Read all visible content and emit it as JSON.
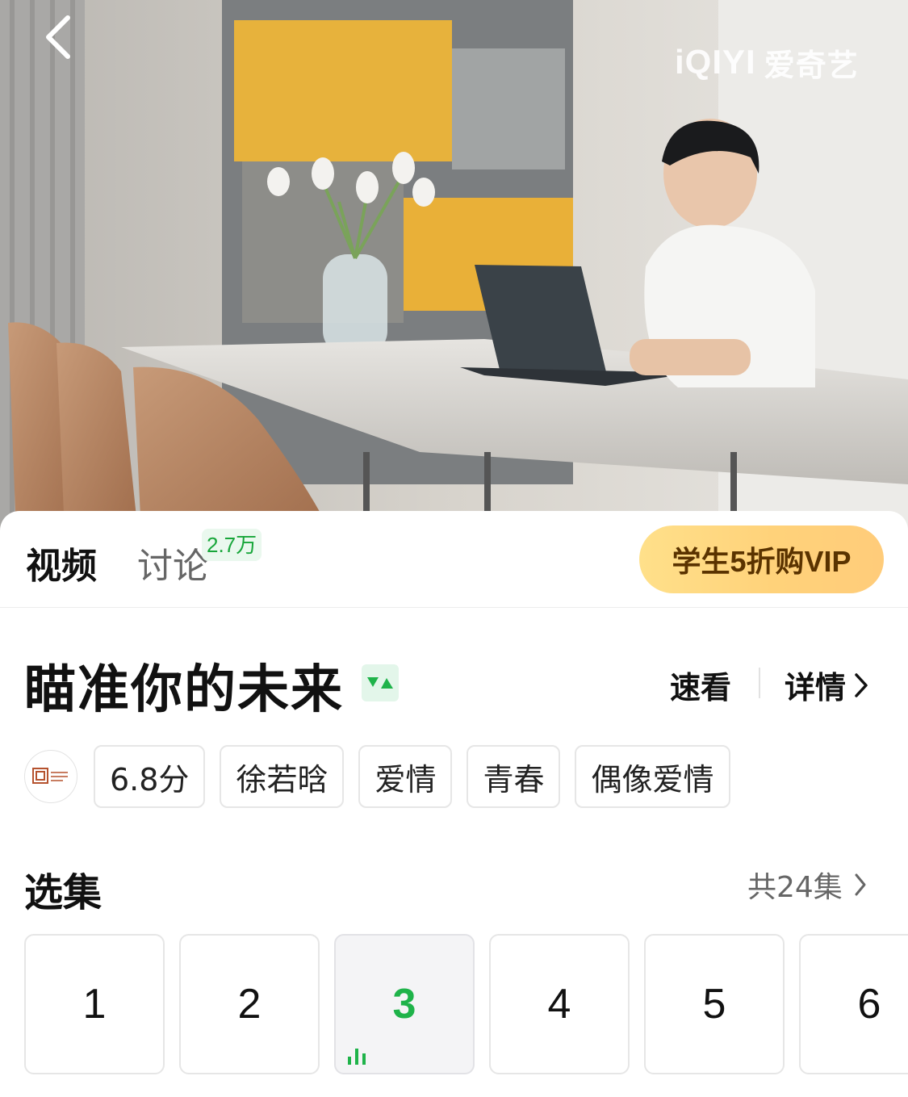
{
  "player": {
    "watermark_latin": "iQIYI",
    "watermark_cjk": "爱奇艺"
  },
  "tabs": {
    "video": "视频",
    "discuss": "讨论",
    "discuss_count": "2.7万"
  },
  "vip_button": "学生5折购VIP",
  "show": {
    "title": "瞄准你的未来",
    "quick_watch": "速看",
    "details": "详情"
  },
  "tags": {
    "score": "6.8分",
    "actor": "徐若晗",
    "genre1": "爱情",
    "genre2": "青春",
    "genre3": "偶像爱情"
  },
  "episodes": {
    "title": "选集",
    "total": "共24集",
    "items": [
      "1",
      "2",
      "3",
      "4",
      "5",
      "6"
    ],
    "active": "3"
  },
  "colors": {
    "accent_green": "#1fb34a",
    "vip_gold": "#ffd27a",
    "vip_text": "#5a3300"
  }
}
